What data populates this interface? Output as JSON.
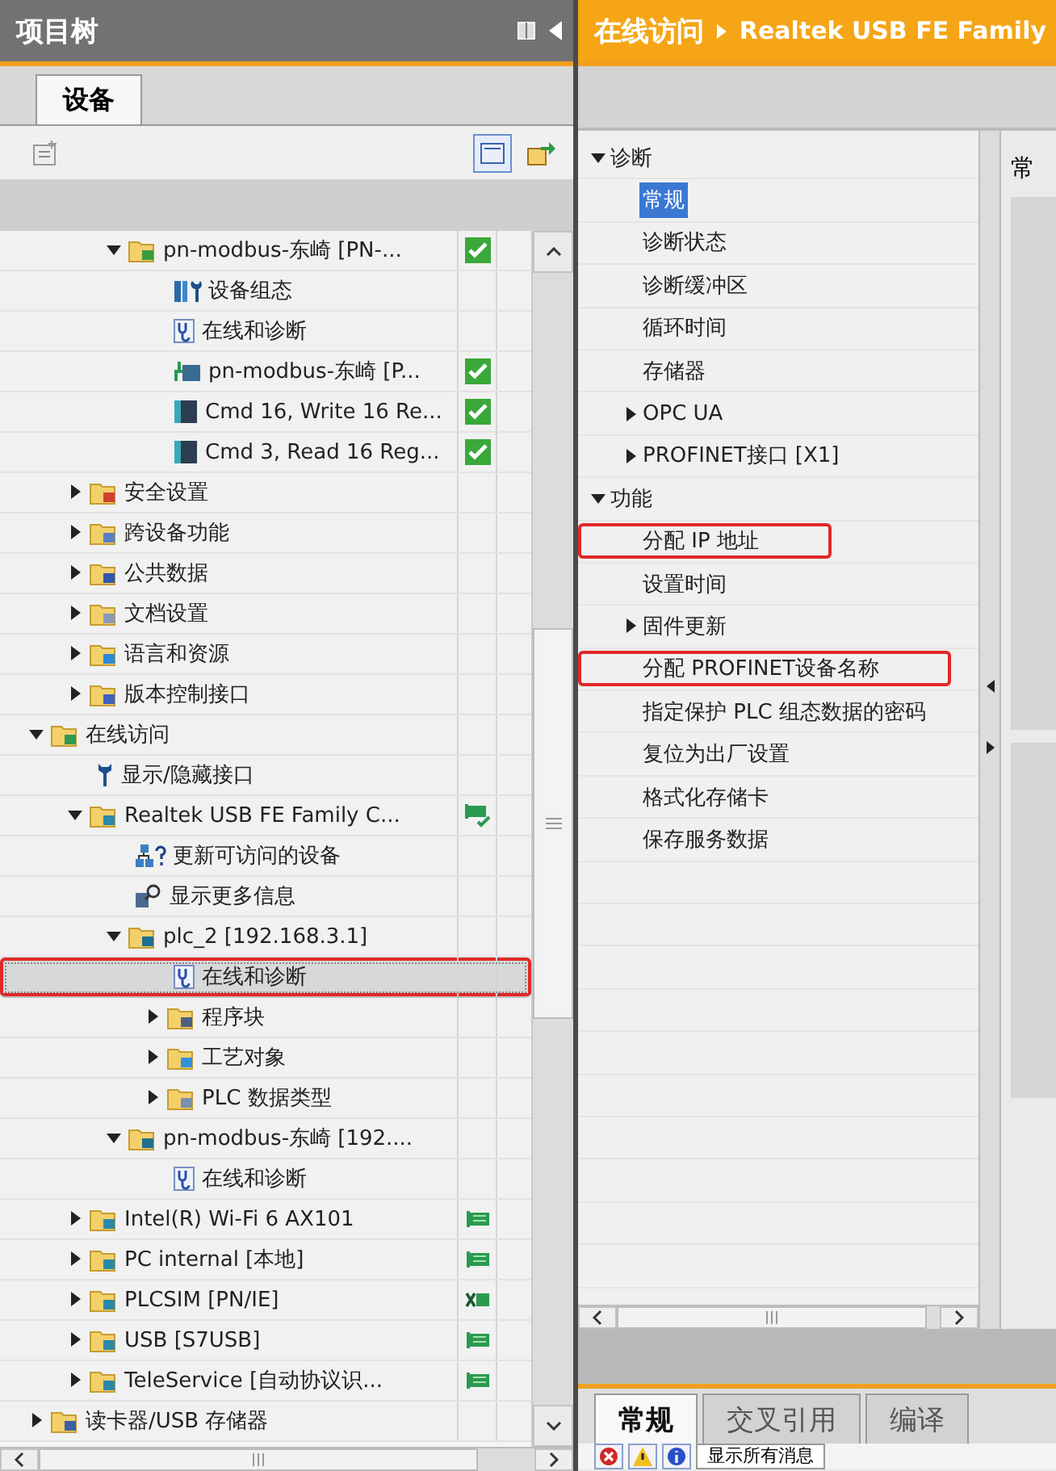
{
  "project_tree": {
    "title": "项目树",
    "tabs": [
      {
        "label": "设备",
        "selected": true
      }
    ],
    "tree": [
      {
        "children": [
          {
            "children": [
              {
                "label": "pn-modbus-东崎 [PN-...",
                "kind": "station",
                "status": {
                  "kind": "ok"
                },
                "expanded": true,
                "selected": false,
                "marked": false,
                "children": [
                  {
                    "label": "设备组态",
                    "kind": "config",
                    "selected": false,
                    "marked": false
                  },
                  {
                    "label": "在线和诊断",
                    "kind": "diag",
                    "selected": false,
                    "marked": false
                  },
                  {
                    "label": "pn-modbus-东崎 [P...",
                    "kind": "netdev",
                    "status": {
                      "kind": "ok"
                    },
                    "selected": false,
                    "marked": false
                  },
                  {
                    "label": "Cmd 16, Write 16 Re...",
                    "kind": "module",
                    "status": {
                      "kind": "ok"
                    },
                    "selected": false,
                    "marked": false
                  },
                  {
                    "label": "Cmd 3, Read 16 Reg...",
                    "kind": "module",
                    "status": {
                      "kind": "ok"
                    },
                    "selected": false,
                    "marked": false
                  }
                ]
              }
            ]
          },
          {
            "label": "安全设置",
            "kind": "security",
            "expanded": false,
            "selected": false,
            "marked": false
          },
          {
            "label": "跨设备功能",
            "kind": "cross",
            "expanded": false,
            "selected": false,
            "marked": false
          },
          {
            "label": "公共数据",
            "kind": "common",
            "expanded": false,
            "selected": false,
            "marked": false
          },
          {
            "label": "文档设置",
            "kind": "doc",
            "expanded": false,
            "selected": false,
            "marked": false
          },
          {
            "label": "语言和资源",
            "kind": "lang",
            "expanded": false,
            "selected": false,
            "marked": false
          },
          {
            "label": "版本控制接口",
            "kind": "version",
            "expanded": false,
            "selected": false,
            "marked": false
          }
        ]
      },
      {
        "label": "在线访问",
        "kind": "online",
        "expanded": true,
        "selected": false,
        "marked": false,
        "children": [
          {
            "label": "显示/隐藏接口",
            "kind": "wrench",
            "selected": false,
            "marked": false
          },
          {
            "label": "Realtek USB FE Family C...",
            "kind": "adapter",
            "status": {
              "kind": "online-ok"
            },
            "expanded": true,
            "selected": false,
            "marked": false,
            "children": [
              {
                "label": "更新可访问的设备",
                "kind": "update",
                "selected": false,
                "marked": false
              },
              {
                "label": "显示更多信息",
                "kind": "info",
                "selected": false,
                "marked": false
              },
              {
                "label": "plc_2 [192.168.3.1]",
                "kind": "plc",
                "expanded": true,
                "selected": false,
                "marked": false,
                "children": [
                  {
                    "label": "在线和诊断",
                    "kind": "diag",
                    "selected": true,
                    "marked": true
                  },
                  {
                    "label": "程序块",
                    "kind": "blocks",
                    "expanded": false,
                    "selected": false,
                    "marked": false
                  },
                  {
                    "label": "工艺对象",
                    "kind": "tech",
                    "expanded": false,
                    "selected": false,
                    "marked": false
                  },
                  {
                    "label": "PLC 数据类型",
                    "kind": "types",
                    "expanded": false,
                    "selected": false,
                    "marked": false
                  }
                ]
              },
              {
                "label": "pn-modbus-东崎 [192....",
                "kind": "plc",
                "expanded": true,
                "selected": false,
                "marked": false,
                "children": [
                  {
                    "label": "在线和诊断",
                    "kind": "diag",
                    "selected": false,
                    "marked": false
                  }
                ]
              }
            ]
          },
          {
            "label": "Intel(R) Wi-Fi 6 AX101",
            "kind": "adapter",
            "status": {
              "kind": "online"
            },
            "expanded": false,
            "selected": false,
            "marked": false
          },
          {
            "label": "PC internal [本地]",
            "kind": "adapter",
            "status": {
              "kind": "online"
            },
            "expanded": false,
            "selected": false,
            "marked": false
          },
          {
            "label": "PLCSIM [PN/IE]",
            "kind": "adapter",
            "status": {
              "kind": "disconnected"
            },
            "expanded": false,
            "selected": false,
            "marked": false
          },
          {
            "label": "USB [S7USB]",
            "kind": "adapter",
            "status": {
              "kind": "online"
            },
            "expanded": false,
            "selected": false,
            "marked": false
          },
          {
            "label": "TeleService [自动协议识...",
            "kind": "adapter",
            "status": {
              "kind": "online"
            },
            "expanded": false,
            "selected": false,
            "marked": false
          }
        ]
      },
      {
        "label": "读卡器/USB 存储器",
        "kind": "reader",
        "expanded": false,
        "selected": false,
        "marked": false
      }
    ]
  },
  "online_access": {
    "breadcrumb": [
      "在线访问",
      "Realtek USB FE Family"
    ],
    "nav": [
      {
        "label": "诊断",
        "expanded": true,
        "selected": false,
        "marked": false,
        "children": [
          {
            "label": "常规",
            "selected": true,
            "marked": false
          },
          {
            "label": "诊断状态",
            "selected": false,
            "marked": false
          },
          {
            "label": "诊断缓冲区",
            "selected": false,
            "marked": false
          },
          {
            "label": "循环时间",
            "selected": false,
            "marked": false
          },
          {
            "label": "存储器",
            "selected": false,
            "marked": false
          },
          {
            "label": "OPC UA",
            "expanded": false,
            "selected": false,
            "marked": false
          },
          {
            "label": "PROFINET接口 [X1]",
            "expanded": false,
            "selected": false,
            "marked": false
          }
        ]
      },
      {
        "label": "功能",
        "expanded": true,
        "selected": false,
        "marked": false,
        "children": [
          {
            "label": "分配 IP 地址",
            "selected": false,
            "marked": true
          },
          {
            "label": "设置时间",
            "selected": false,
            "marked": false
          },
          {
            "label": "固件更新",
            "expanded": false,
            "selected": false,
            "marked": false
          },
          {
            "label": "分配 PROFINET设备名称",
            "selected": false,
            "marked": true
          },
          {
            "label": "指定保护 PLC 组态数据的密码",
            "selected": false,
            "marked": false
          },
          {
            "label": "复位为出厂设置",
            "selected": false,
            "marked": false
          },
          {
            "label": "格式化存储卡",
            "selected": false,
            "marked": false
          },
          {
            "label": "保存服务数据",
            "selected": false,
            "marked": false
          }
        ]
      }
    ],
    "detail": {
      "heading": "常"
    }
  },
  "inspector": {
    "tabs": [
      {
        "label": "常规",
        "selected": true
      },
      {
        "label": "交叉引用",
        "selected": false
      },
      {
        "label": "编译",
        "selected": false
      }
    ],
    "filter": "显示所有消息"
  }
}
